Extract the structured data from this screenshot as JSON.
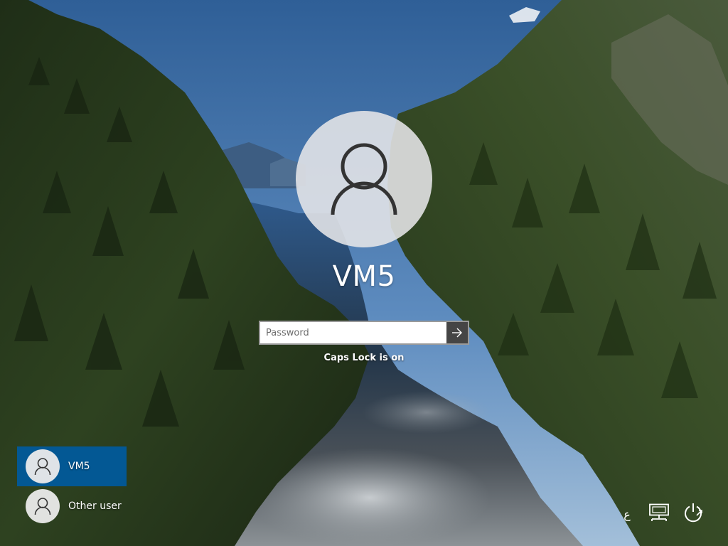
{
  "login": {
    "username": "VM5",
    "password_placeholder": "Password",
    "password_value": "",
    "caps_lock_message": "Caps Lock is on",
    "submit_icon": "arrow-right-icon"
  },
  "user_list": [
    {
      "name": "VM5",
      "selected": true,
      "icon": "user-icon"
    },
    {
      "name": "Other user",
      "selected": false,
      "icon": "user-icon"
    }
  ],
  "tray": {
    "language_indicator": "ع",
    "network_icon": "network-icon",
    "power_icon": "power-icon"
  },
  "colors": {
    "selected_user_bg": "#005a9e",
    "submit_button_bg": "#454545"
  }
}
